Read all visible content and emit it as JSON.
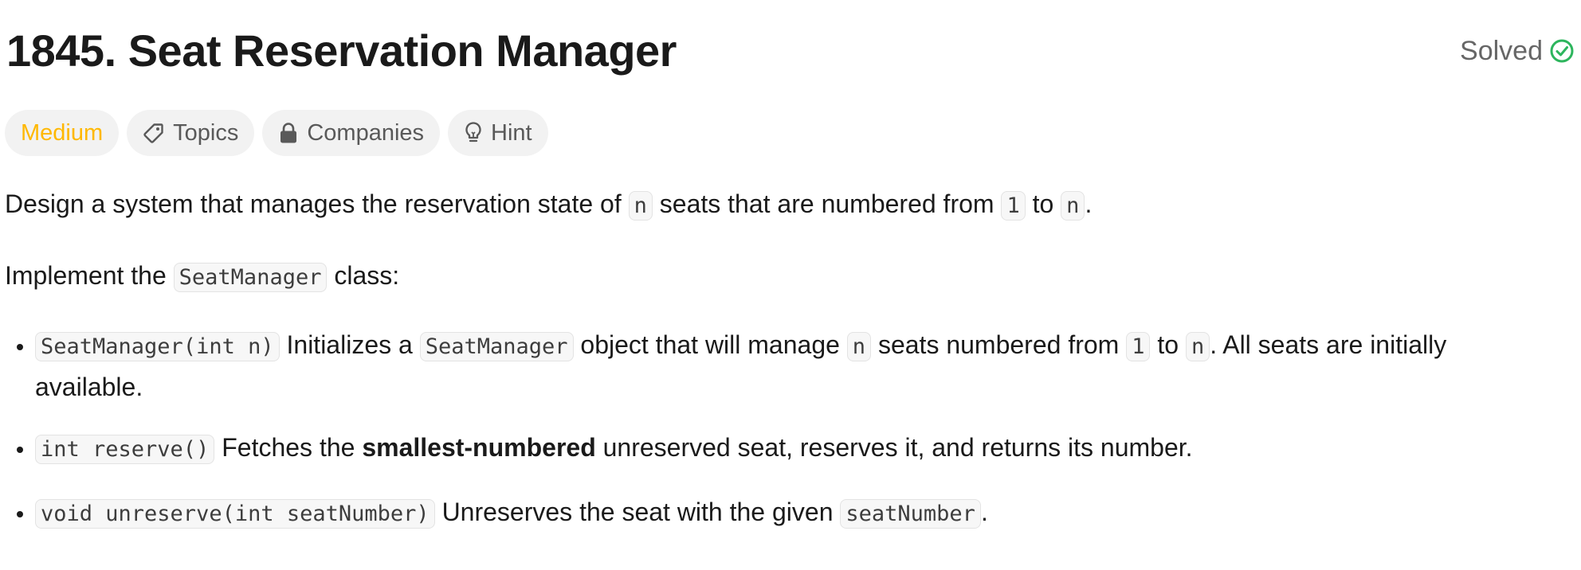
{
  "problem": {
    "title": "1845. Seat Reservation Manager",
    "status": "Solved",
    "tags": {
      "difficulty": "Medium",
      "topics": "Topics",
      "companies": "Companies",
      "hint": "Hint"
    }
  },
  "description": {
    "p1": {
      "t1": "Design a system that manages the reservation state of ",
      "c1": "n",
      "t2": " seats that are numbered from ",
      "c2": "1",
      "t3": " to ",
      "c3": "n",
      "t4": "."
    },
    "p2": {
      "t1": "Implement the ",
      "c1": "SeatManager",
      "t2": " class:"
    },
    "items": [
      {
        "c1": "SeatManager(int n)",
        "t1": " Initializes a ",
        "c2": "SeatManager",
        "t2": " object that will manage ",
        "c3": "n",
        "t3": " seats numbered from ",
        "c4": "1",
        "t4": " to ",
        "c5": "n",
        "t5": ". All seats are initially available."
      },
      {
        "c1": "int reserve()",
        "t1": " Fetches the ",
        "b1": "smallest-numbered",
        "t2": " unreserved seat, reserves it, and returns its number."
      },
      {
        "c1": "void unreserve(int seatNumber)",
        "t1": " Unreserves the seat with the given ",
        "c2": "seatNumber",
        "t2": "."
      }
    ]
  },
  "colors": {
    "difficulty_medium": "#ffb800",
    "solved_check": "#2db55d",
    "tag_background": "#f2f2f2"
  },
  "icons": {
    "solved": "check-circle-icon",
    "topics": "tag-icon",
    "companies": "lock-icon",
    "hint": "lightbulb-icon"
  }
}
